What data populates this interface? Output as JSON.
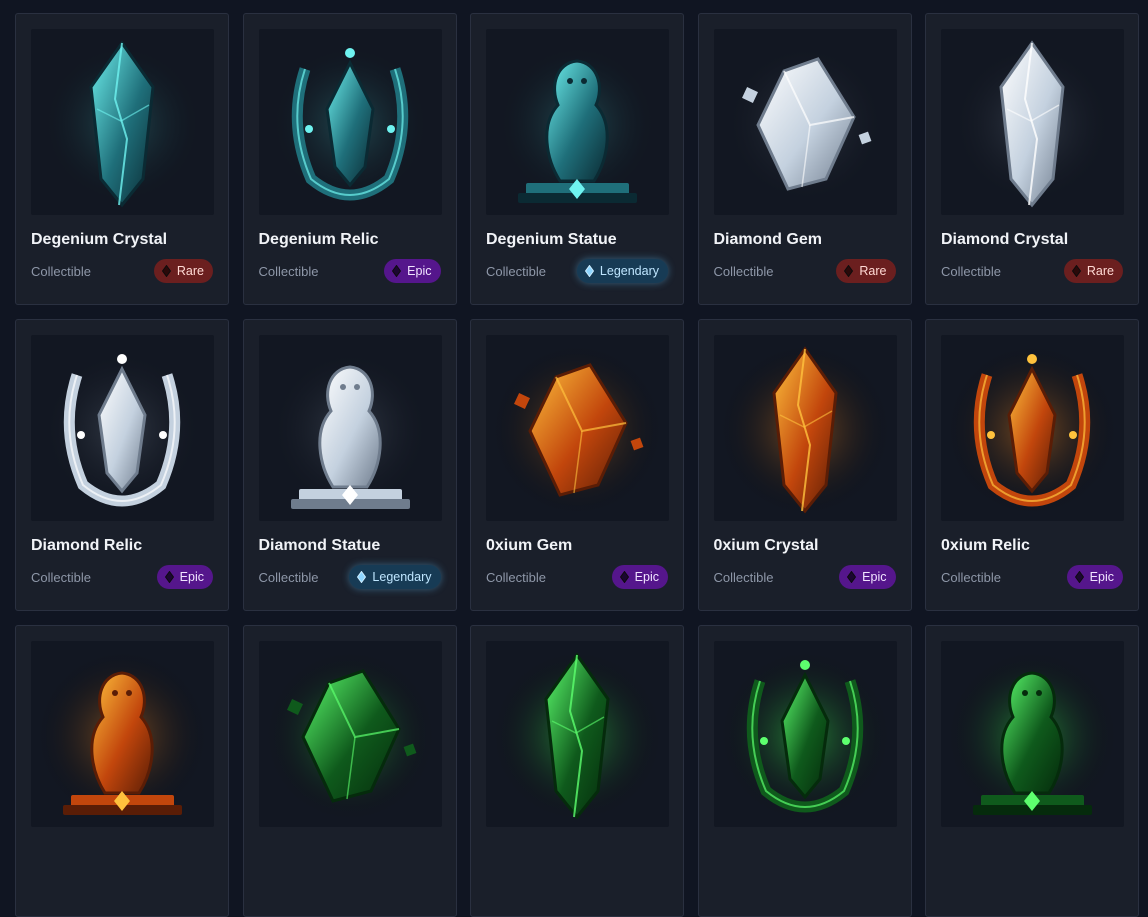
{
  "colors": {
    "rare": "#6b1f1f",
    "epic": "#55168c",
    "legendary": "#173b55",
    "degenium": "#3fd6d6",
    "diamond": "#dfe8f2",
    "oxium": "#ff8c1a",
    "binary": "#33ff55"
  },
  "items": [
    {
      "name": "Degenium Crystal",
      "category": "Collectible",
      "rarity": "Rare",
      "rarity_icon": "rare-gem-icon",
      "theme": "degenium",
      "shape": "crystal"
    },
    {
      "name": "Degenium Relic",
      "category": "Collectible",
      "rarity": "Epic",
      "rarity_icon": "epic-gem-icon",
      "theme": "degenium",
      "shape": "relic"
    },
    {
      "name": "Degenium Statue",
      "category": "Collectible",
      "rarity": "Legendary",
      "rarity_icon": "legendary-gem-icon",
      "theme": "degenium",
      "shape": "statue"
    },
    {
      "name": "Diamond Gem",
      "category": "Collectible",
      "rarity": "Rare",
      "rarity_icon": "rare-gem-icon",
      "theme": "diamond",
      "shape": "gem"
    },
    {
      "name": "Diamond Crystal",
      "category": "Collectible",
      "rarity": "Rare",
      "rarity_icon": "rare-gem-icon",
      "theme": "diamond",
      "shape": "crystal"
    },
    {
      "name": "Diamond Relic",
      "category": "Collectible",
      "rarity": "Epic",
      "rarity_icon": "epic-gem-icon",
      "theme": "diamond",
      "shape": "relic"
    },
    {
      "name": "Diamond Statue",
      "category": "Collectible",
      "rarity": "Legendary",
      "rarity_icon": "legendary-gem-icon",
      "theme": "diamond",
      "shape": "statue"
    },
    {
      "name": "0xium Gem",
      "category": "Collectible",
      "rarity": "Epic",
      "rarity_icon": "epic-gem-icon",
      "theme": "oxium",
      "shape": "gem"
    },
    {
      "name": "0xium Crystal",
      "category": "Collectible",
      "rarity": "Epic",
      "rarity_icon": "epic-gem-icon",
      "theme": "oxium",
      "shape": "crystal"
    },
    {
      "name": "0xium Relic",
      "category": "Collectible",
      "rarity": "Epic",
      "rarity_icon": "epic-gem-icon",
      "theme": "oxium",
      "shape": "relic"
    },
    {
      "name": "",
      "category": "",
      "rarity": "",
      "theme": "oxium",
      "shape": "statue"
    },
    {
      "name": "",
      "category": "",
      "rarity": "",
      "theme": "binary",
      "shape": "gem"
    },
    {
      "name": "",
      "category": "",
      "rarity": "",
      "theme": "binary",
      "shape": "crystal"
    },
    {
      "name": "",
      "category": "",
      "rarity": "",
      "theme": "binary",
      "shape": "relic"
    },
    {
      "name": "",
      "category": "",
      "rarity": "",
      "theme": "binary",
      "shape": "statue"
    }
  ]
}
